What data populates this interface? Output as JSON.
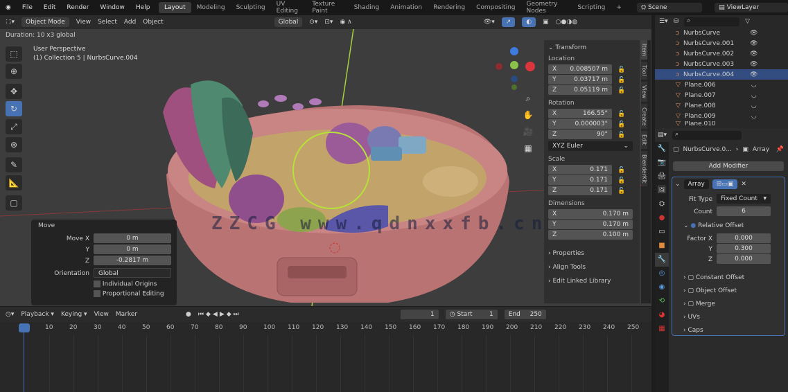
{
  "menu": [
    "File",
    "Edit",
    "Render",
    "Window",
    "Help"
  ],
  "workspaces": [
    {
      "label": "Layout",
      "active": true
    },
    {
      "label": "Modeling"
    },
    {
      "label": "Sculpting"
    },
    {
      "label": "UV Editing"
    },
    {
      "label": "Texture Paint"
    },
    {
      "label": "Shading"
    },
    {
      "label": "Animation"
    },
    {
      "label": "Rendering"
    },
    {
      "label": "Compositing"
    },
    {
      "label": "Geometry Nodes"
    },
    {
      "label": "Scripting"
    }
  ],
  "add_workspace": "+",
  "scene": "Scene",
  "view_layer": "ViewLayer",
  "viewport_header": {
    "mode": "Object Mode",
    "menus": [
      "View",
      "Select",
      "Add",
      "Object"
    ],
    "orientation": "Global"
  },
  "status_text": "Duration: 10 x3 global",
  "viewport": {
    "view_name": "User Perspective",
    "collection": "(1) Collection 5 | NurbsCurve.004",
    "watermark": "ZZCG www.qdnxxfb.cn"
  },
  "move_panel": {
    "title": "Move",
    "fields": [
      {
        "label": "Move X",
        "value": "0 m"
      },
      {
        "label": "Y",
        "value": "0 m"
      },
      {
        "label": "Z",
        "value": "-0.2817 m"
      }
    ],
    "orientation_label": "Orientation",
    "orientation": "Global",
    "checks": [
      "Individual Origins",
      "Proportional Editing"
    ]
  },
  "transform": {
    "title": "Transform",
    "location_label": "Location",
    "location": [
      {
        "axis": "X",
        "value": "0.008507 m"
      },
      {
        "axis": "Y",
        "value": "0.03717 m"
      },
      {
        "axis": "Z",
        "value": "0.05119 m"
      }
    ],
    "rotation_label": "Rotation",
    "rotation": [
      {
        "axis": "X",
        "value": "166.55°"
      },
      {
        "axis": "Y",
        "value": "0.000003°"
      },
      {
        "axis": "Z",
        "value": "90°"
      }
    ],
    "rotation_mode": "XYZ Euler",
    "scale_label": "Scale",
    "scale": [
      {
        "axis": "X",
        "value": "0.171"
      },
      {
        "axis": "Y",
        "value": "0.171"
      },
      {
        "axis": "Z",
        "value": "0.171"
      }
    ],
    "dimensions_label": "Dimensions",
    "dimensions": [
      {
        "axis": "X",
        "value": "0.170 m"
      },
      {
        "axis": "Y",
        "value": "0.170 m"
      },
      {
        "axis": "Z",
        "value": "0.100 m"
      }
    ],
    "sections": [
      "Properties",
      "Align Tools",
      "Edit Linked Library"
    ]
  },
  "ntabs": [
    "Item",
    "Tool",
    "View",
    "Create",
    "Edit",
    "BlenderKit"
  ],
  "outliner": {
    "items": [
      {
        "name": "NurbsCurve",
        "type": "curve"
      },
      {
        "name": "NurbsCurve.001",
        "type": "curve"
      },
      {
        "name": "NurbsCurve.002",
        "type": "curve"
      },
      {
        "name": "NurbsCurve.003",
        "type": "curve"
      },
      {
        "name": "NurbsCurve.004",
        "type": "curve",
        "selected": true
      },
      {
        "name": "Plane.006",
        "type": "mesh"
      },
      {
        "name": "Plane.007",
        "type": "mesh"
      },
      {
        "name": "Plane.008",
        "type": "mesh"
      },
      {
        "name": "Plane.009",
        "type": "mesh"
      },
      {
        "name": "Plane.010",
        "type": "mesh"
      }
    ]
  },
  "properties": {
    "object": "NurbsCurve.0...",
    "modifier_path": "Array",
    "add_modifier": "Add Modifier",
    "modifier_name": "Array",
    "fit_type_label": "Fit Type",
    "fit_type": "Fixed Count",
    "count_label": "Count",
    "count": "6",
    "relative_offset": "Relative Offset",
    "factor": [
      {
        "label": "Factor X",
        "value": "0.000"
      },
      {
        "label": "Y",
        "value": "0.300"
      },
      {
        "label": "Z",
        "value": "0.000"
      }
    ],
    "subpanels": [
      "Constant Offset",
      "Object Offset",
      "Merge",
      "UVs",
      "Caps"
    ]
  },
  "timeline": {
    "menus": [
      "Playback",
      "Keying",
      "View",
      "Marker"
    ],
    "current_frame": "1",
    "start_label": "Start",
    "start": "1",
    "end_label": "End",
    "end": "250",
    "ticks": [
      "1",
      "10",
      "20",
      "30",
      "40",
      "50",
      "60",
      "70",
      "80",
      "90",
      "100",
      "110",
      "120",
      "130",
      "140",
      "150",
      "160",
      "170",
      "180",
      "190",
      "200",
      "210",
      "220",
      "230",
      "240",
      "250"
    ]
  },
  "colors": {
    "accent": "#4772b3",
    "bowl": "#c27a7a",
    "axis_x": "#d9363e",
    "axis_y": "#8bc34a",
    "axis_z": "#3d7be0"
  }
}
